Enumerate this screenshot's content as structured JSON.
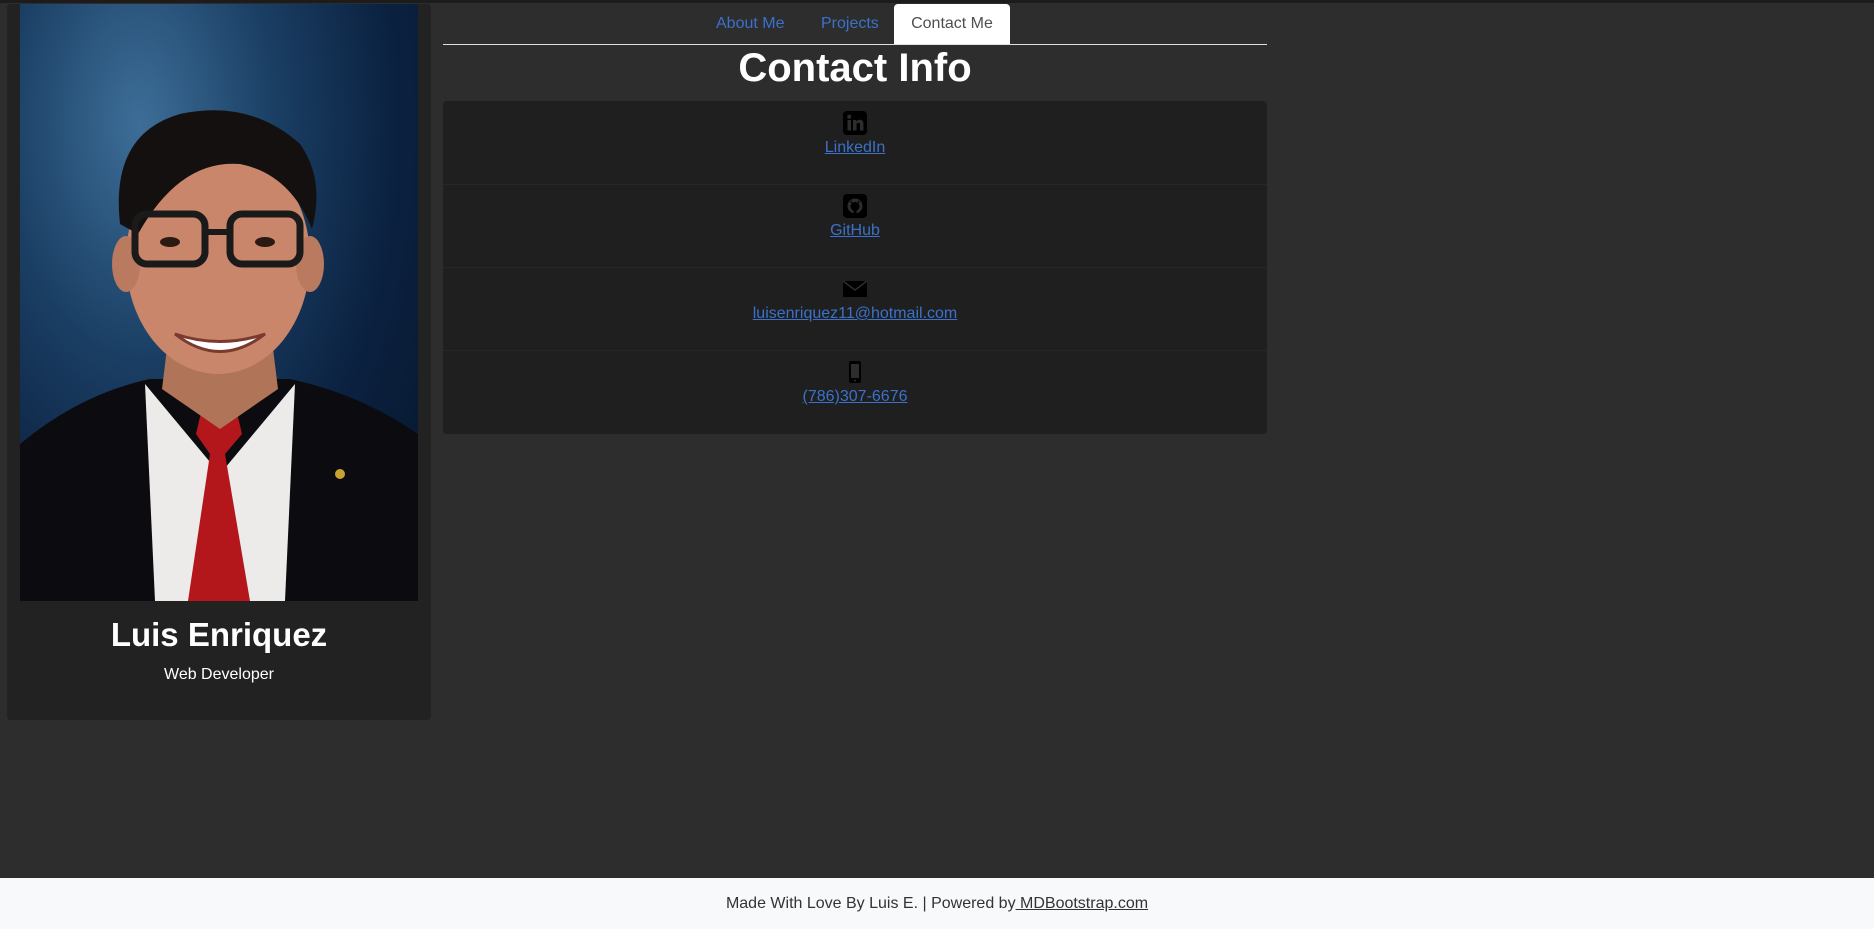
{
  "profile": {
    "name": "Luis Enriquez",
    "role": "Web Developer"
  },
  "nav": {
    "tabs": [
      {
        "label": "About Me",
        "active": false
      },
      {
        "label": "Projects",
        "active": false
      },
      {
        "label": "Contact Me",
        "active": true
      }
    ]
  },
  "contact": {
    "title": "Contact Info",
    "items": [
      {
        "icon": "linkedin-icon",
        "label": "LinkedIn"
      },
      {
        "icon": "github-icon",
        "label": "GitHub"
      },
      {
        "icon": "envelope-icon",
        "label": "luisenriquez11@hotmail.com"
      },
      {
        "icon": "phone-icon",
        "label": "(786)307-6676"
      }
    ]
  },
  "footer": {
    "text": "Made With Love By Luis E. | Powered by",
    "link": " MDBootstrap.com"
  },
  "colors": {
    "page_bg": "#2d2d2d",
    "card_bg": "#222222",
    "link": "#3b71ca",
    "footer_bg": "#f8f9fa"
  }
}
